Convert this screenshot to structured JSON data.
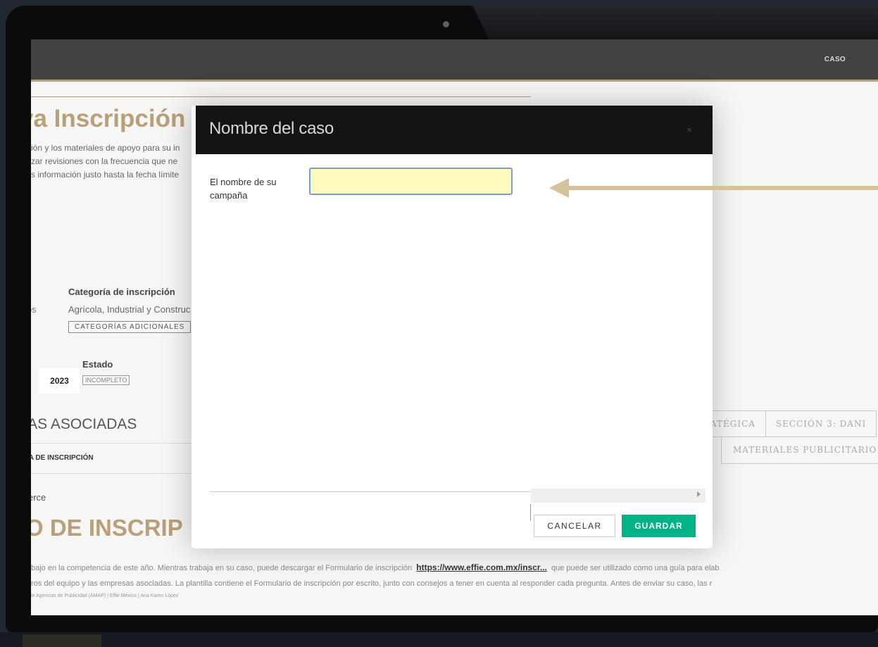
{
  "topnav": {
    "caso_label": "CASO"
  },
  "page": {
    "title": "va Inscripción",
    "intro_lines": [
      "ión y los materiales de apoyo para su in",
      "zar revisiones con la frecuencia que ne",
      "s información justo hasta la fecha límite"
    ]
  },
  "details": {
    "category_label": "Categoría de inscripción",
    "category_prefix": "os",
    "category_value": "Agrícola, Industrial y Construc",
    "additional_categories_button": "CATEGORÍAS ADICIONALES",
    "status_label": "Estado",
    "year_mark": "(",
    "year": "2023",
    "status_badge": "INCOMPLETO"
  },
  "associated": {
    "title": "DAS ASOCIADAS",
    "column_header": "ÍA DE INSCRIPCIÓN",
    "row_value": "erce"
  },
  "form_section": {
    "title": "O DE INSCRIP"
  },
  "tabs_row1": [
    "ATÉGICA",
    "SECCIÓN 3: DANI"
  ],
  "tabs_row2": [
    "MATERIALES PUBLICITARIO"
  ],
  "bottom": {
    "line1_before": "bajo en la competencia de este año. Mientras trabaja en su caso, puede descargar el Formulario de inscripción",
    "link_text": "https://www.effie.com.mx/inscr...",
    "line1_after": "que puede ser utilizado como una guía para elab",
    "line2": "ros del equipo y las empresas asociadas. La plantilla contiene el Formulario de inscripción por escrito, junto con consejos a tener en cuenta al responder cada pregunta. Antes de enviar su caso, las r",
    "footer": "le Agencias de Publicidad (AMAP)   |   Effie México   |   Ana Karen López"
  },
  "modal": {
    "title": "Nombre del caso",
    "close_symbol": "×",
    "field_label": "El nombre de su campaña",
    "field_value": "",
    "field_placeholder": "",
    "cancel_label": "CANCELAR",
    "save_label": "GUARDAR"
  },
  "colors": {
    "gold_accent": "#b8a078",
    "save_green": "#00b386",
    "input_highlight": "#fcfbbd",
    "arrow": "#d6c19a"
  }
}
